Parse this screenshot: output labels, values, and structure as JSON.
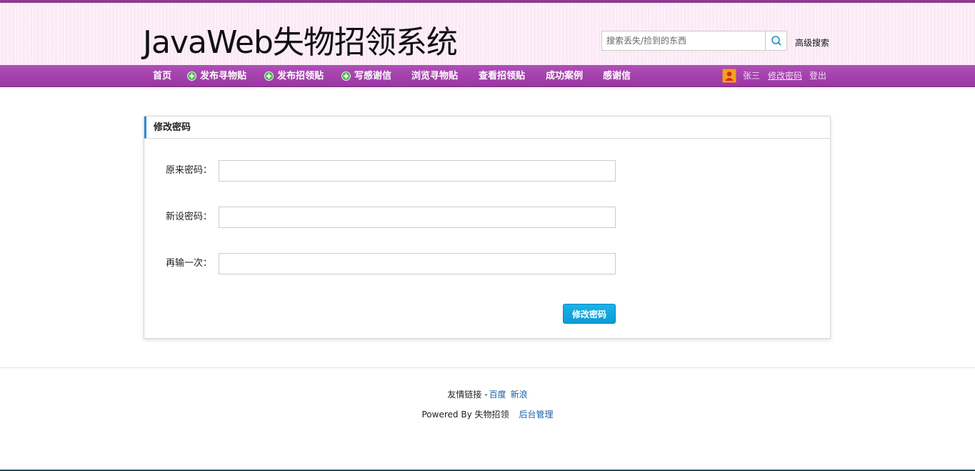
{
  "header": {
    "site_title": "JavaWeb失物招领系统",
    "search_placeholder": "搜索丢失/捡到的东西",
    "search_icon": "search-icon",
    "advanced_search": "高级搜索"
  },
  "nav": {
    "items": [
      {
        "label": "首页",
        "icon": null
      },
      {
        "label": "发布寻物贴",
        "icon": "plus-circle-icon"
      },
      {
        "label": "发布招领贴",
        "icon": "plus-circle-icon"
      },
      {
        "label": "写感谢信",
        "icon": "plus-circle-icon"
      },
      {
        "label": "浏览寻物贴",
        "icon": null
      },
      {
        "label": "查看招领贴",
        "icon": null
      },
      {
        "label": "成功案例",
        "icon": null
      },
      {
        "label": "感谢信",
        "icon": null
      }
    ],
    "user": {
      "name": "张三",
      "change_password": "修改密码",
      "logout": "登出"
    }
  },
  "panel": {
    "title": "修改密码",
    "fields": [
      {
        "label": "原来密码：",
        "value": ""
      },
      {
        "label": "新设密码：",
        "value": ""
      },
      {
        "label": "再输一次：",
        "value": ""
      }
    ],
    "submit_label": "修改密码"
  },
  "footer": {
    "links_label": "友情链接 -",
    "links": [
      "百度",
      "新浪"
    ],
    "powered_by": "Powered By 失物招领",
    "admin_link": "后台管理"
  },
  "colors": {
    "header_bg": "#fbe9f6",
    "nav_bg": "#a13fab",
    "accent_blue": "#0e9bd6",
    "link": "#1a5ea8"
  }
}
